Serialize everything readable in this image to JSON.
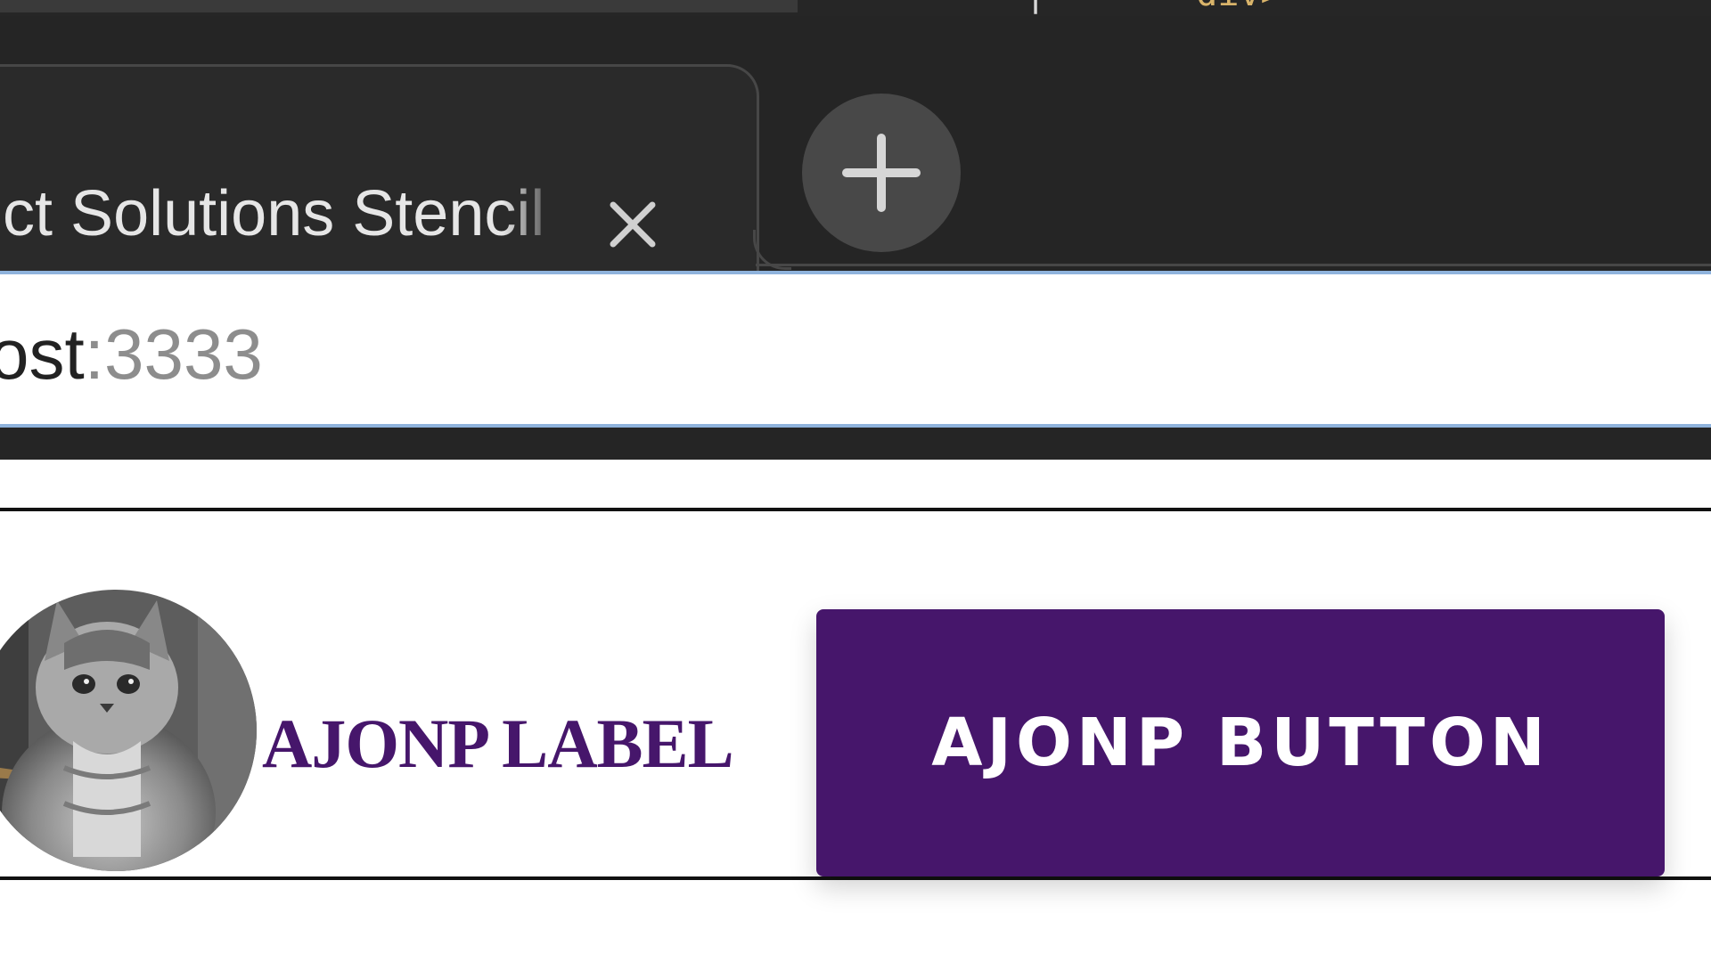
{
  "code_strip": {
    "snippet_a": "|",
    "snippet_b": "div>"
  },
  "tab": {
    "title": "ect Solutions Stencil"
  },
  "icons": {
    "close": "close-icon",
    "new_tab": "plus-icon"
  },
  "address": {
    "host": "ost",
    "separator": ":",
    "port": "3333"
  },
  "content": {
    "label": "AJONP LABEL",
    "button": "AJONP BUTTON",
    "avatar": "kitten-avatar"
  },
  "colors": {
    "brand": "#46166b",
    "chrome_bg": "#252525",
    "focus": "#8fb3dc"
  }
}
